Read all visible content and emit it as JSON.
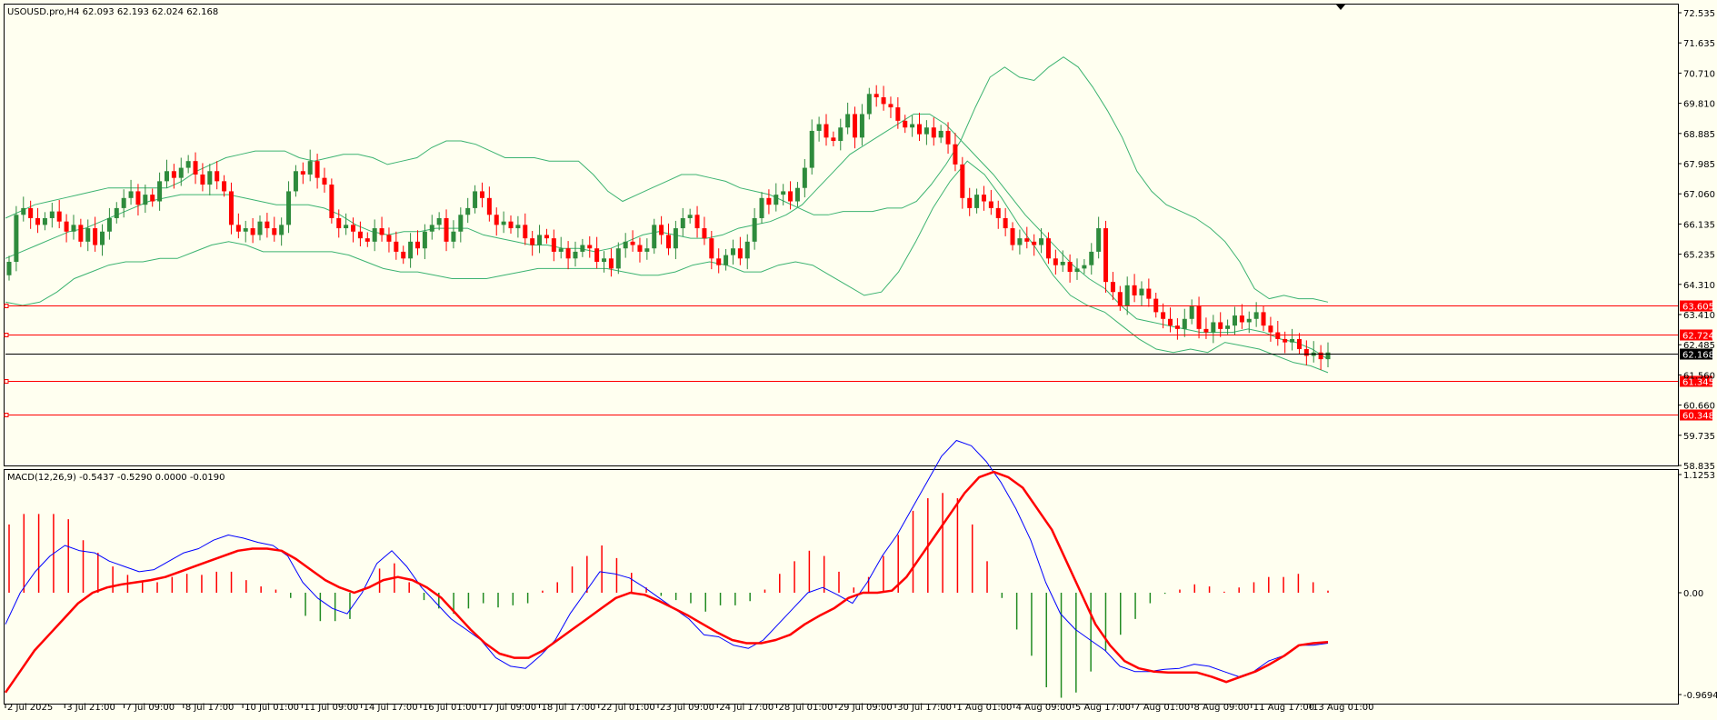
{
  "symbol_header": "USOUSD.pro,H4  62.093 62.193 62.024 62.168",
  "macd_header": "MACD(12,26,9) -0.5437 -0.5290 0.0000 -0.0190",
  "colors": {
    "background": "#fffff0",
    "bull": "#2e8b3c",
    "bear": "#ff0000",
    "bands": "#3cb371",
    "macd_line": "#0000ff",
    "signal_line": "#ff0000",
    "hist_pos": "#ff0000",
    "hist_neg": "#228b22",
    "level_line": "#ff0000",
    "price_line": "#000000"
  },
  "price_axis": [
    "72.535",
    "71.635",
    "70.710",
    "69.810",
    "68.885",
    "67.985",
    "67.060",
    "66.135",
    "65.235",
    "64.310",
    "63.410",
    "62.485",
    "61.560",
    "60.660",
    "59.735",
    "58.835"
  ],
  "macd_axis": [
    "1.1253",
    "0.00",
    "-0.9694"
  ],
  "levels": [
    {
      "label": "63.605",
      "price": 63.605
    },
    {
      "label": "62.724",
      "price": 62.724
    },
    {
      "label": "61.345",
      "price": 61.345
    },
    {
      "label": "60.348",
      "price": 60.348
    }
  ],
  "current_price": {
    "label": "62.168",
    "price": 62.168
  },
  "time_axis": [
    "2 Jul 2025",
    "3 Jul 21:00",
    "7 Jul 09:00",
    "8 Jul 17:00",
    "10 Jul 01:00",
    "11 Jul 09:00",
    "14 Jul 17:00",
    "16 Jul 01:00",
    "17 Jul 09:00",
    "18 Jul 17:00",
    "22 Jul 01:00",
    "23 Jul 09:00",
    "24 Jul 17:00",
    "28 Jul 01:00",
    "29 Jul 09:00",
    "30 Jul 17:00",
    "1 Aug 01:00",
    "4 Aug 09:00",
    "5 Aug 17:00",
    "7 Aug 01:00",
    "8 Aug 09:00",
    "11 Aug 17:00",
    "13 Aug 01:00"
  ],
  "chart_data": [
    {
      "type": "candlestick",
      "title": "USOUSD.pro,H4",
      "ylim": [
        58.835,
        72.535
      ],
      "series": [
        {
          "name": "close",
          "values": [
            64.9,
            66.3,
            66.5,
            66.2,
            66.0,
            66.2,
            66.4,
            66.1,
            65.8,
            66.0,
            65.5,
            65.9,
            65.4,
            65.8,
            66.2,
            66.5,
            66.8,
            67.0,
            66.6,
            66.9,
            66.7,
            67.3,
            67.6,
            67.4,
            67.7,
            67.9,
            67.5,
            67.2,
            67.6,
            67.3,
            67.0,
            66.0,
            65.8,
            65.9,
            65.7,
            66.1,
            65.9,
            65.7,
            66.0,
            67.0,
            67.6,
            67.5,
            67.9,
            67.4,
            67.2,
            66.2,
            65.9,
            66.0,
            65.8,
            65.6,
            65.5,
            65.9,
            65.7,
            65.5,
            65.2,
            65.0,
            65.5,
            65.3,
            65.8,
            66.0,
            66.2,
            65.5,
            65.8,
            66.3,
            66.5,
            67.0,
            66.8,
            66.3,
            66.0,
            66.1,
            65.9,
            66.0,
            65.6,
            65.4,
            65.7,
            65.6,
            65.2,
            65.3,
            65.0,
            65.2,
            65.4,
            65.3,
            64.9,
            65.0,
            64.7,
            65.3,
            65.5,
            65.4,
            65.2,
            65.3,
            66.0,
            65.7,
            65.3,
            65.9,
            66.2,
            66.3,
            65.9,
            65.6,
            65.0,
            64.8,
            65.1,
            65.3,
            65.0,
            65.5,
            66.2,
            66.8,
            66.6,
            66.9,
            67.0,
            66.7,
            67.1,
            67.7,
            68.8,
            69.0,
            68.6,
            68.5,
            68.9,
            69.3,
            68.6,
            69.3,
            69.9,
            69.8,
            69.6,
            69.5,
            69.1,
            68.9,
            69.0,
            68.7,
            68.9,
            68.6,
            68.8,
            68.4,
            67.8,
            66.8,
            66.5,
            66.9,
            66.7,
            66.5,
            66.2,
            65.9,
            65.4,
            65.6,
            65.5,
            65.4,
            65.6,
            65.0,
            64.8,
            64.9,
            64.6,
            64.7,
            64.8,
            65.2,
            65.9,
            64.3,
            64.0,
            63.6,
            64.2,
            63.9,
            64.1,
            63.8,
            63.4,
            63.2,
            63.0,
            62.9,
            63.2,
            63.6,
            62.9,
            62.8,
            63.1,
            62.9,
            63.0,
            63.3,
            63.1,
            63.2,
            63.4,
            63.0,
            62.8,
            62.6,
            62.5,
            62.6,
            62.3,
            62.1,
            62.2,
            62.0,
            62.2
          ]
        },
        {
          "name": "upper band",
          "values": [
            66.2,
            66.4,
            66.6,
            66.7,
            66.8,
            66.9,
            67.0,
            67.1,
            67.1,
            67.1,
            67.1,
            67.1,
            67.3,
            67.6,
            67.8,
            68.0,
            68.1,
            68.2,
            68.2,
            68.2,
            68.0,
            67.9,
            68.0,
            68.1,
            68.1,
            68.0,
            67.8,
            67.9,
            68.0,
            68.3,
            68.5,
            68.5,
            68.4,
            68.2,
            68.0,
            68.0,
            68.0,
            67.9,
            67.9,
            67.9,
            67.5,
            67.0,
            66.7,
            66.9,
            67.1,
            67.3,
            67.5,
            67.5,
            67.4,
            67.3,
            67.1,
            67.0,
            66.9,
            66.7,
            66.5,
            66.3,
            66.3,
            66.4,
            66.4,
            66.4,
            66.5,
            66.5,
            66.7,
            67.2,
            67.8,
            68.5,
            69.5,
            70.4,
            70.7,
            70.4,
            70.3,
            70.7,
            71.0,
            70.7,
            70.1,
            69.4,
            68.6,
            67.6,
            67.0,
            66.6,
            66.4,
            66.2,
            65.9,
            65.5,
            64.9,
            64.1,
            63.8,
            63.9,
            63.8,
            63.8,
            63.7
          ]
        },
        {
          "name": "middle band",
          "values": [
            65.0,
            65.2,
            65.4,
            65.6,
            65.8,
            65.9,
            66.1,
            66.3,
            66.5,
            66.7,
            66.8,
            66.9,
            66.9,
            66.9,
            66.9,
            66.8,
            66.7,
            66.6,
            66.6,
            66.6,
            66.5,
            66.3,
            66.0,
            65.8,
            65.7,
            65.8,
            65.8,
            65.9,
            65.9,
            65.9,
            65.7,
            65.6,
            65.5,
            65.4,
            65.4,
            65.3,
            65.3,
            65.2,
            65.3,
            65.5,
            65.7,
            65.8,
            65.7,
            65.6,
            65.6,
            65.7,
            65.9,
            66.0,
            66.1,
            66.3,
            66.6,
            67.1,
            67.6,
            68.1,
            68.4,
            68.7,
            69.0,
            69.3,
            69.3,
            69.0,
            68.5,
            68.0,
            67.5,
            66.9,
            66.3,
            65.8,
            65.3,
            64.8,
            64.4,
            64.1,
            63.6,
            63.2,
            63.1,
            63.0,
            62.9,
            62.8,
            62.8,
            62.8,
            62.9,
            62.8,
            62.6,
            62.5,
            62.3,
            62.0
          ]
        },
        {
          "name": "lower band",
          "values": [
            63.7,
            63.6,
            63.7,
            64.0,
            64.4,
            64.6,
            64.8,
            64.9,
            64.9,
            65.0,
            65.0,
            65.2,
            65.4,
            65.5,
            65.4,
            65.2,
            65.2,
            65.2,
            65.2,
            65.2,
            65.1,
            64.9,
            64.7,
            64.6,
            64.6,
            64.5,
            64.4,
            64.4,
            64.4,
            64.5,
            64.6,
            64.7,
            64.7,
            64.7,
            64.7,
            64.7,
            64.6,
            64.5,
            64.5,
            64.6,
            64.8,
            64.9,
            64.8,
            64.6,
            64.6,
            64.8,
            64.9,
            64.8,
            64.5,
            64.2,
            63.9,
            64.0,
            64.6,
            65.5,
            66.5,
            67.3,
            67.9,
            67.5,
            66.8,
            66.0,
            65.3,
            64.5,
            63.9,
            63.6,
            63.4,
            63.0,
            62.6,
            62.3,
            62.2,
            62.3,
            62.2,
            62.5,
            62.4,
            62.3,
            62.1,
            61.9,
            61.8,
            61.6
          ]
        }
      ]
    },
    {
      "type": "line",
      "title": "MACD(12,26,9)",
      "ylim": [
        -0.9694,
        1.1253
      ],
      "series": [
        {
          "name": "macd",
          "values": [
            -0.3,
            0.0,
            0.2,
            0.35,
            0.45,
            0.4,
            0.38,
            0.3,
            0.25,
            0.2,
            0.22,
            0.3,
            0.38,
            0.42,
            0.5,
            0.55,
            0.52,
            0.48,
            0.45,
            0.35,
            0.1,
            -0.05,
            -0.15,
            -0.2,
            0.0,
            0.28,
            0.4,
            0.25,
            0.05,
            -0.1,
            -0.25,
            -0.35,
            -0.45,
            -0.62,
            -0.7,
            -0.72,
            -0.6,
            -0.45,
            -0.2,
            0.0,
            0.2,
            0.18,
            0.14,
            0.05,
            -0.05,
            -0.15,
            -0.25,
            -0.4,
            -0.42,
            -0.5,
            -0.53,
            -0.45,
            -0.3,
            -0.15,
            0.0,
            0.05,
            -0.02,
            -0.1,
            0.1,
            0.35,
            0.55,
            0.8,
            1.05,
            1.3,
            1.45,
            1.4,
            1.25,
            1.05,
            0.8,
            0.5,
            0.1,
            -0.2,
            -0.35,
            -0.45,
            -0.55,
            -0.7,
            -0.75,
            -0.75,
            -0.73,
            -0.72,
            -0.68,
            -0.7,
            -0.75,
            -0.8,
            -0.75,
            -0.65,
            -0.6,
            -0.5,
            -0.5,
            -0.48
          ]
        },
        {
          "name": "signal",
          "values": [
            -0.95,
            -0.75,
            -0.55,
            -0.4,
            -0.25,
            -0.1,
            0.0,
            0.05,
            0.08,
            0.1,
            0.12,
            0.15,
            0.2,
            0.25,
            0.3,
            0.35,
            0.4,
            0.42,
            0.42,
            0.4,
            0.32,
            0.22,
            0.12,
            0.05,
            0.0,
            0.05,
            0.12,
            0.15,
            0.12,
            0.05,
            -0.05,
            -0.2,
            -0.35,
            -0.48,
            -0.58,
            -0.62,
            -0.62,
            -0.55,
            -0.45,
            -0.35,
            -0.25,
            -0.15,
            -0.05,
            0.0,
            -0.02,
            -0.08,
            -0.15,
            -0.22,
            -0.3,
            -0.38,
            -0.45,
            -0.48,
            -0.48,
            -0.45,
            -0.4,
            -0.3,
            -0.22,
            -0.15,
            -0.05,
            0.0,
            0.0,
            0.02,
            0.15,
            0.35,
            0.55,
            0.75,
            0.95,
            1.1,
            1.15,
            1.1,
            1.0,
            0.8,
            0.6,
            0.3,
            0.0,
            -0.3,
            -0.5,
            -0.65,
            -0.72,
            -0.75,
            -0.76,
            -0.76,
            -0.76,
            -0.8,
            -0.85,
            -0.8,
            -0.75,
            -0.68,
            -0.6,
            -0.5,
            -0.48,
            -0.47
          ]
        },
        {
          "name": "histogram",
          "values": [
            0.65,
            0.75,
            0.75,
            0.75,
            0.7,
            0.5,
            0.38,
            0.25,
            0.17,
            0.1,
            0.1,
            0.15,
            0.18,
            0.17,
            0.2,
            0.2,
            0.12,
            0.06,
            0.03,
            -0.05,
            -0.22,
            -0.27,
            -0.27,
            -0.25,
            0.0,
            0.23,
            0.28,
            0.1,
            -0.07,
            -0.15,
            -0.2,
            -0.15,
            -0.1,
            -0.14,
            -0.12,
            -0.1,
            0.02,
            0.1,
            0.25,
            0.35,
            0.45,
            0.33,
            0.19,
            0.05,
            -0.03,
            -0.07,
            -0.1,
            -0.18,
            -0.12,
            -0.12,
            -0.08,
            0.03,
            0.18,
            0.3,
            0.4,
            0.35,
            0.2,
            0.05,
            0.15,
            0.35,
            0.55,
            0.78,
            0.9,
            0.95,
            0.9,
            0.65,
            0.3,
            -0.05,
            -0.35,
            -0.6,
            -0.9,
            -1.0,
            -0.95,
            -0.75,
            -0.55,
            -0.4,
            -0.25,
            -0.1,
            -0.01,
            0.03,
            0.08,
            0.06,
            0.01,
            0.05,
            0.1,
            0.15,
            0.15,
            0.18,
            0.1,
            0.02
          ]
        }
      ]
    }
  ]
}
